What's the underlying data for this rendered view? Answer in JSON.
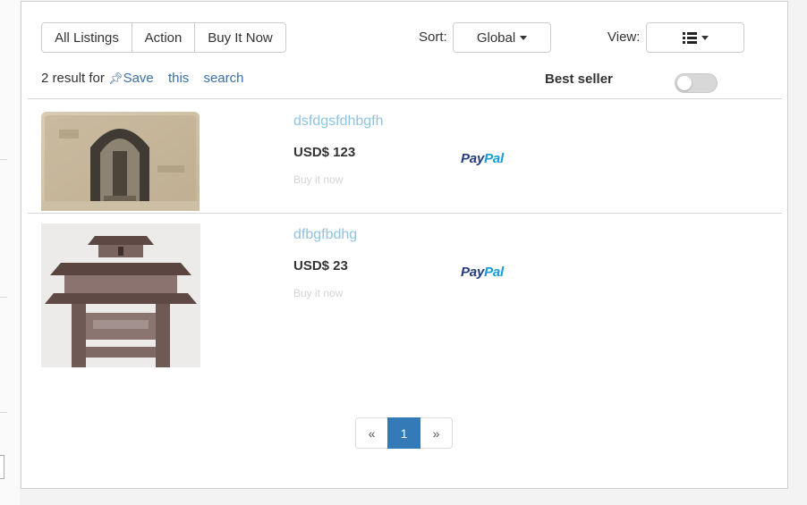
{
  "filters": {
    "tabs": [
      {
        "label": "All Listings"
      },
      {
        "label": "Action"
      },
      {
        "label": "Buy It Now"
      }
    ]
  },
  "sort": {
    "label": "Sort:",
    "value": "Global"
  },
  "view": {
    "label": "View:",
    "icon": "list-view-icon"
  },
  "results": {
    "count_text": "2 result for",
    "save_words": [
      "Save",
      "this",
      "search"
    ],
    "pin_icon": "pushpin-icon"
  },
  "best_seller": {
    "label": "Best seller",
    "enabled": false
  },
  "listings": [
    {
      "title": "dsfdgsfdhbgfh",
      "price": "USD$ 123",
      "buy_label": "Buy it now",
      "payment": {
        "pay": "Pay",
        "pal": "Pal"
      },
      "image": "old-stone-arch-photo"
    },
    {
      "title": "dfbgfbdhg",
      "price": "USD$ 23",
      "buy_label": "Buy it now",
      "payment": {
        "pay": "Pay",
        "pal": "Pal"
      },
      "image": "chinese-gate-photo"
    }
  ],
  "pagination": {
    "prev": "«",
    "current": "1",
    "next": "»"
  },
  "colors": {
    "accent": "#337ab7",
    "title_link": "#8cc4e2",
    "link": "#3a6fa8",
    "paypal_dark": "#253b80",
    "paypal_light": "#179bd7"
  }
}
